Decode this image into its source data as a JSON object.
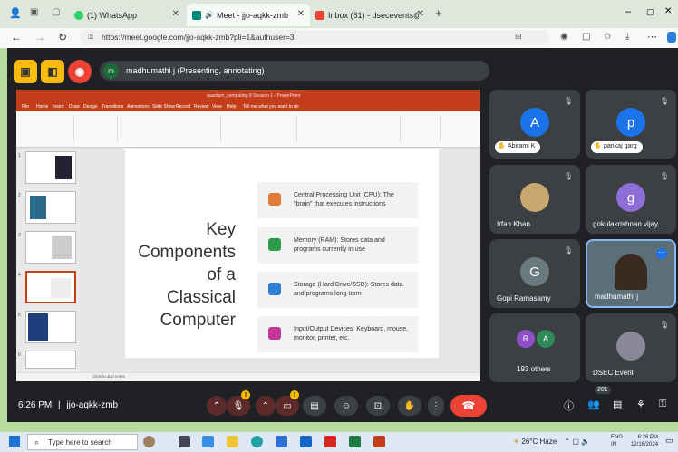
{
  "browser": {
    "tabs": [
      {
        "label": "(1) WhatsApp"
      },
      {
        "label": "Meet - jjo-aqkk-zmb"
      },
      {
        "label": "Inbox (61) - dsecevents@dsengg"
      }
    ],
    "url": "https://meet.google.com/jjo-aqkk-zmb?pli=1&authuser=3"
  },
  "meet": {
    "presenter_initial": "m",
    "presenter_label": "madhumathi j (Presenting, annotating)",
    "time": "6:26 PM",
    "separator": "|",
    "meeting_code": "jjo-aqkk-zmb",
    "participant_count": "201",
    "mic_badge": "!",
    "cam_badge": "!",
    "participants": [
      {
        "initial": "A",
        "name": "Abirami K",
        "color": "#1a73e8",
        "hand": true
      },
      {
        "initial": "p",
        "name": "pankaj garg",
        "color": "#1a73e8",
        "hand": true
      },
      {
        "initial": "",
        "name": "Irfan Khan",
        "color": "#c8a870",
        "hand": false
      },
      {
        "initial": "g",
        "name": "gokulakrishnan vijay...",
        "color": "#8e6fd8",
        "hand": false
      },
      {
        "initial": "G",
        "name": "Gopi Ramasamy",
        "color": "#6b7a80",
        "hand": false
      },
      {
        "initial": "",
        "name": "madhumathi j",
        "color": "#5a6f77",
        "hand": false
      },
      {
        "initial": "",
        "name": "193 others",
        "color": "",
        "hand": false
      },
      {
        "initial": "",
        "name": "DSEC Event",
        "color": "#889",
        "hand": false
      }
    ],
    "others_initials": [
      "R",
      "A"
    ]
  },
  "powerpoint": {
    "title": "quantum_computing-8 Session 1 - PowerPoint",
    "ribbon_tabs": [
      "File",
      "Home",
      "Insert",
      "Draw",
      "Design",
      "Transitions",
      "Animations",
      "Slide Show",
      "Record",
      "Review",
      "View",
      "Help",
      "Tell me what you want to do"
    ],
    "slide_title": "Key Components of a Classical Computer",
    "cards": [
      {
        "text": "Central Processing Unit (CPU): The \"brain\" that executes instructions",
        "icon_color": "#e07b39"
      },
      {
        "text": "Memory (RAM): Stores data and programs currently in use",
        "icon_color": "#2e9b4a"
      },
      {
        "text": "Storage (Hard Drive/SSD): Stores data and programs long-term",
        "icon_color": "#2f7fd1"
      },
      {
        "text": "Input/Output Devices: Keyboard, mouse, monitor, printer, etc.",
        "icon_color": "#c2389a"
      }
    ],
    "notes_placeholder": "Click to add notes",
    "thumb_numbers": [
      "1",
      "2",
      "3",
      "4",
      "5",
      "6"
    ]
  },
  "taskbar": {
    "search_placeholder": "Type here to search",
    "weather": "26°C  Haze",
    "lang": "ENG",
    "lang2": "IN",
    "clock_time": "6:26 PM",
    "clock_date": "12/16/2024"
  }
}
